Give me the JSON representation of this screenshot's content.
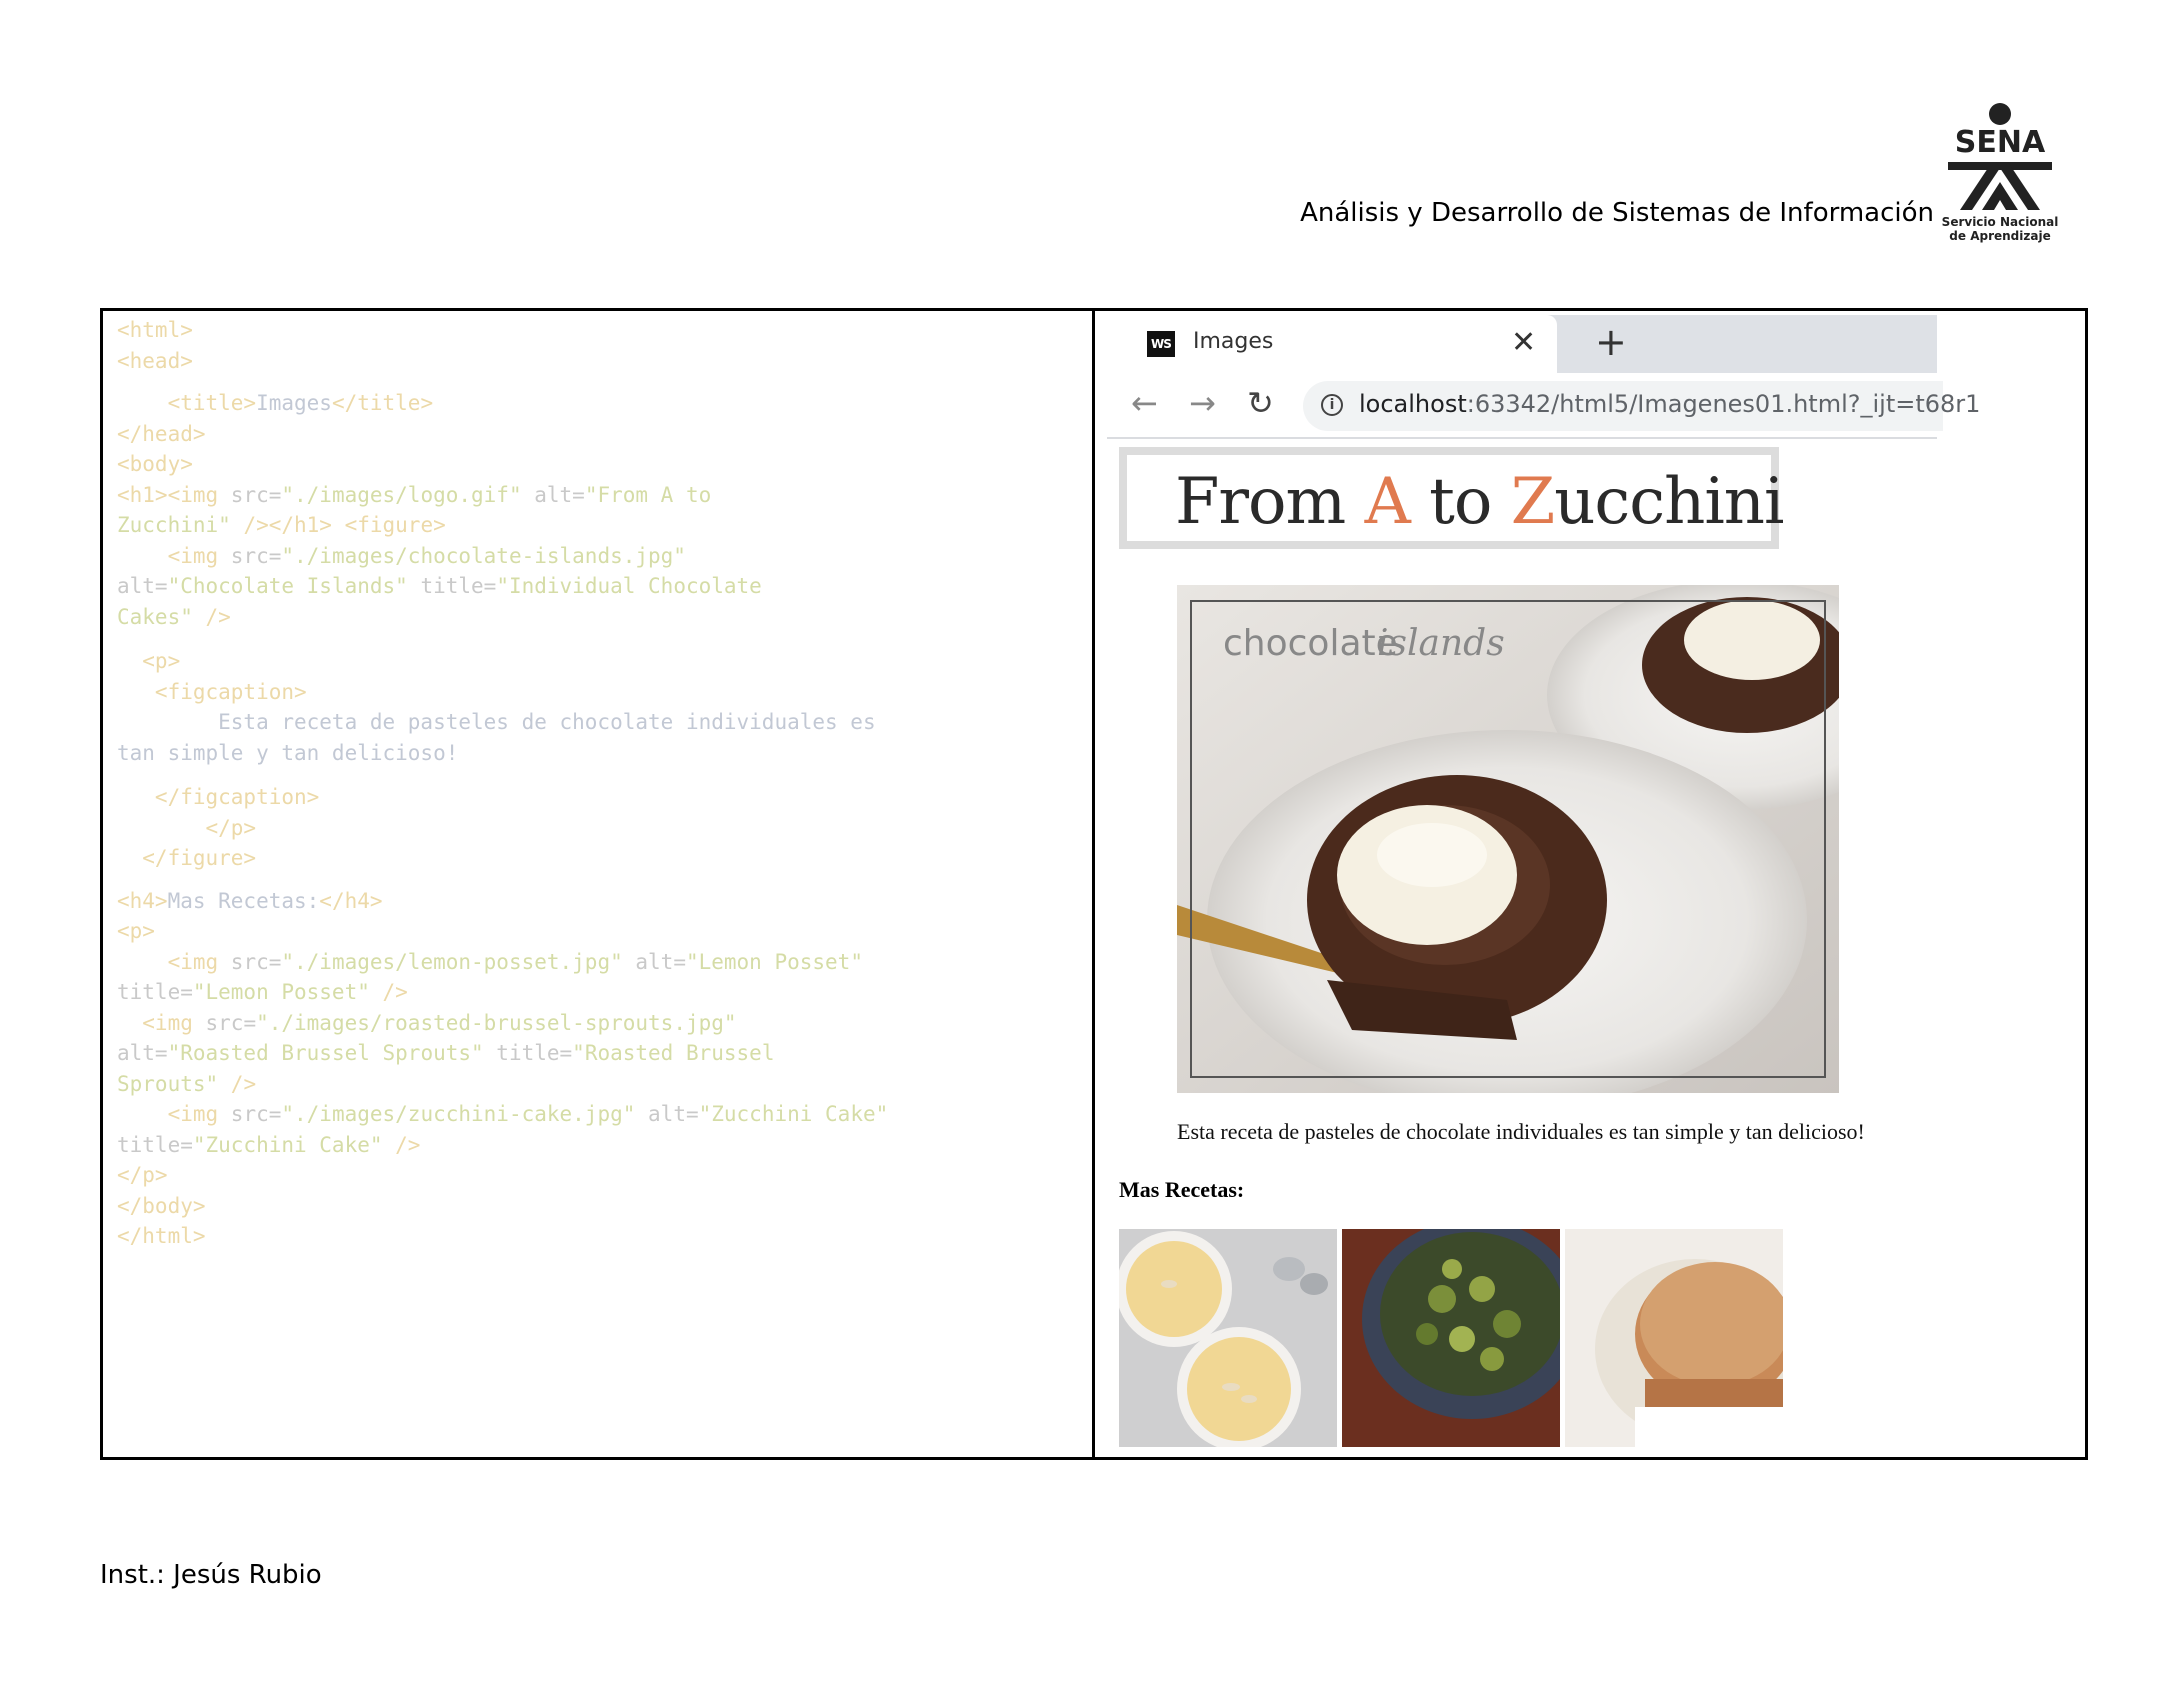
{
  "header": {
    "title": "Análisis y Desarrollo de Sistemas de Información",
    "logo_text": "SENA",
    "logo_subtitle_1": "Servicio Nacional",
    "logo_subtitle_2": "de Aprendizaje"
  },
  "footer": {
    "instructor": "Inst.: Jesús Rubio"
  },
  "code": {
    "l01": "<html>",
    "l02": "<head>",
    "l03_open": "    <title>",
    "l03_text": "Images",
    "l03_close": "</title>",
    "l04": "</head>",
    "l05": "<body>",
    "l06_a": "<h1><img ",
    "l06_b": "src=",
    "l06_c": "\"./images/logo.gif\"",
    "l06_d": " alt=",
    "l06_e": "\"From A to",
    "l07_a": "Zucchini\"",
    "l07_b": " /></h1> <figure>",
    "l08_a": "    <img ",
    "l08_b": "src=",
    "l08_c": "\"./images/chocolate-islands.jpg\"",
    "l09_a": "alt=",
    "l09_b": "\"Chocolate Islands\"",
    "l09_c": " title=",
    "l09_d": "\"Individual Chocolate",
    "l10_a": "Cakes\"",
    "l10_b": " />",
    "l11": "  <p>",
    "l12": "   <figcaption>",
    "l13": "        Esta receta de pasteles de chocolate individuales es",
    "l14": "tan simple y tan delicioso!",
    "l15": "   </figcaption>",
    "l16": "       </p>",
    "l17": "  </figure>",
    "l18_a": "<h4>",
    "l18_b": "Mas Recetas:",
    "l18_c": "</h4>",
    "l19": "<p>",
    "l20_a": "    <img ",
    "l20_b": "src=",
    "l20_c": "\"./images/lemon-posset.jpg\"",
    "l20_d": " alt=",
    "l20_e": "\"Lemon Posset\"",
    "l21_a": "title=",
    "l21_b": "\"Lemon Posset\"",
    "l21_c": " />",
    "l22_a": "  <img ",
    "l22_b": "src=",
    "l22_c": "\"./images/roasted-brussel-sprouts.jpg\"",
    "l23_a": "alt=",
    "l23_b": "\"Roasted Brussel Sprouts\"",
    "l23_c": " title=",
    "l23_d": "\"Roasted Brussel",
    "l24_a": "Sprouts\"",
    "l24_b": " />",
    "l25_a": "    <img ",
    "l25_b": "src=",
    "l25_c": "\"./images/zucchini-cake.jpg\"",
    "l25_d": " alt=",
    "l25_e": "\"Zucchini Cake\"",
    "l26_a": "title=",
    "l26_b": "\"Zucchini Cake\"",
    "l26_c": " />",
    "l27": "</p>",
    "l28": "</body>",
    "l29": "</html>"
  },
  "browser": {
    "favicon_text": "WS",
    "tab_title": "Images",
    "close_glyph": "✕",
    "new_tab_glyph": "+",
    "back_glyph": "←",
    "forward_glyph": "→",
    "reload_glyph": "↻",
    "info_glyph": "i",
    "url_host": "localhost",
    "url_rest": ":63342/html5/Imagenes01.html?_ijt=t68r1"
  },
  "page": {
    "logo_from": "From ",
    "logo_a": "A",
    "logo_to": " to ",
    "logo_z": "Z",
    "logo_ucchini": "ucchini",
    "hero_label_1": "chocolate",
    "hero_label_2": "islands",
    "caption": "Esta receta de pasteles de chocolate individuales es tan simple y tan delicioso!",
    "more_heading": "Mas Recetas:"
  },
  "colors": {
    "logo_accent": "#e07a4f",
    "sena_green": "#39a900"
  }
}
